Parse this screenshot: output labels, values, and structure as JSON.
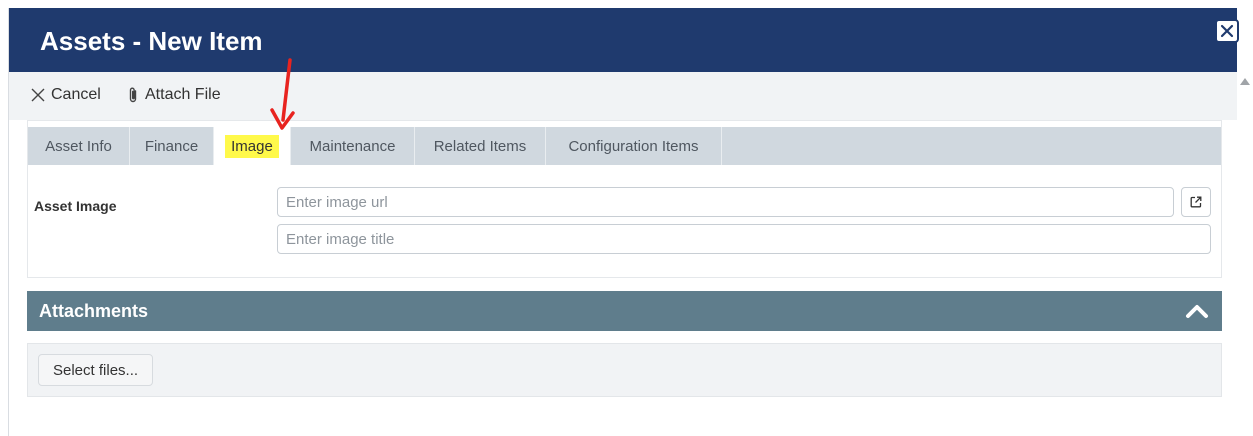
{
  "dialog": {
    "title": "Assets - New Item",
    "close_icon": "close-icon"
  },
  "toolbar": {
    "cancel_label": "Cancel",
    "attach_label": "Attach File"
  },
  "tabs": [
    {
      "label": "Asset Info",
      "active": false
    },
    {
      "label": "Finance",
      "active": false
    },
    {
      "label": "Image",
      "active": true
    },
    {
      "label": "Maintenance",
      "active": false
    },
    {
      "label": "Related Items",
      "active": false
    },
    {
      "label": "Configuration Items",
      "active": false
    }
  ],
  "image_form": {
    "label": "Asset Image",
    "url_placeholder": "Enter image url",
    "url_value": "",
    "title_placeholder": "Enter image title",
    "title_value": ""
  },
  "attachments": {
    "title": "Attachments",
    "select_files_label": "Select files..."
  },
  "colors": {
    "title_bar": "#1f3a6e",
    "section_header": "#5f7d8c",
    "tab_highlight": "#fff94a",
    "annotation_arrow": "#e8231f"
  }
}
